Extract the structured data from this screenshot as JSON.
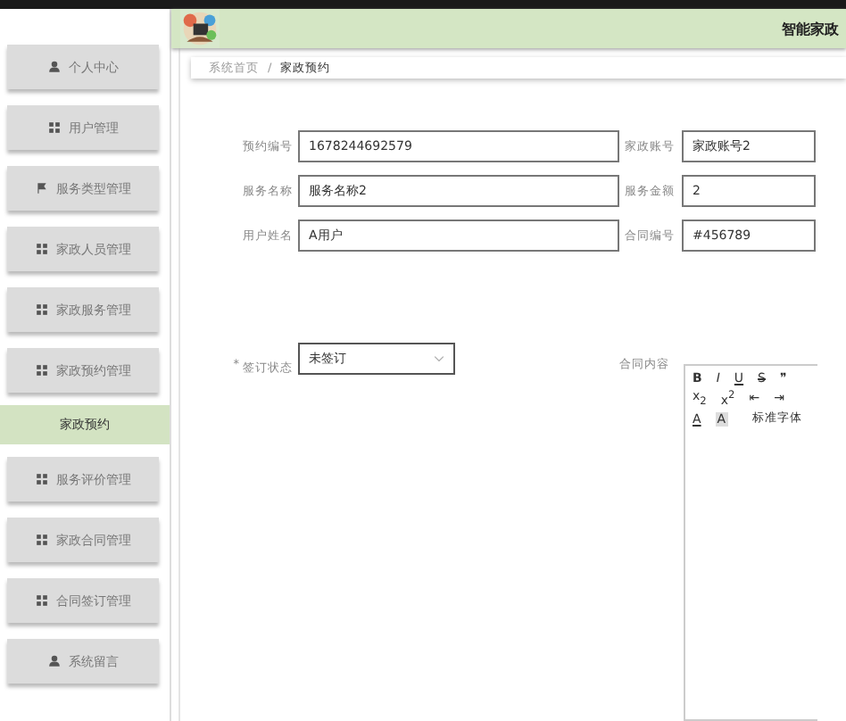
{
  "menu": [
    {
      "label": "个人中心",
      "kind": "person",
      "selected": false
    },
    {
      "label": "用户管理",
      "kind": "grid",
      "selected": false
    },
    {
      "label": "服务类型管理",
      "kind": "flag",
      "selected": false
    },
    {
      "label": "家政人员管理",
      "kind": "grid",
      "selected": false
    },
    {
      "label": "家政服务管理",
      "kind": "grid",
      "selected": false
    },
    {
      "label": "家政预约管理",
      "kind": "grid",
      "selected": false
    },
    {
      "label": "家政预约",
      "kind": "sub",
      "selected": true
    },
    {
      "label": "服务评价管理",
      "kind": "grid",
      "selected": false
    },
    {
      "label": "家政合同管理",
      "kind": "grid",
      "selected": false
    },
    {
      "label": "合同签订管理",
      "kind": "grid",
      "selected": false
    },
    {
      "label": "系统留言",
      "kind": "person",
      "selected": false
    }
  ],
  "header": {
    "title": "智能家政"
  },
  "breadcrumb": {
    "separator": "/",
    "items": [
      "系统首页",
      "家政预约"
    ]
  },
  "form": {
    "rows": [
      {
        "left": {
          "label": "预约编号",
          "value": "1678244692579"
        },
        "right": {
          "label": "家政账号",
          "value": "家政账号2"
        }
      },
      {
        "left": {
          "label": "服务名称",
          "value": "服务名称2"
        },
        "right": {
          "label": "服务金额",
          "value": "2"
        }
      },
      {
        "left": {
          "label": "用户姓名",
          "value": "A用户"
        },
        "right": {
          "label": "合同编号",
          "value": "#456789"
        }
      }
    ],
    "status": {
      "marker": "*",
      "label": "签订状态",
      "value": "未签订"
    },
    "content": {
      "label": "合同内容",
      "toolbar": [
        [
          "B",
          "I",
          "U",
          "S",
          "❞"
        ],
        [
          "x$_{2}$",
          "x$^{2}$",
          "⇤",
          "⇥"
        ],
        [
          "A",
          "A",
          "标准字体"
        ]
      ]
    }
  }
}
